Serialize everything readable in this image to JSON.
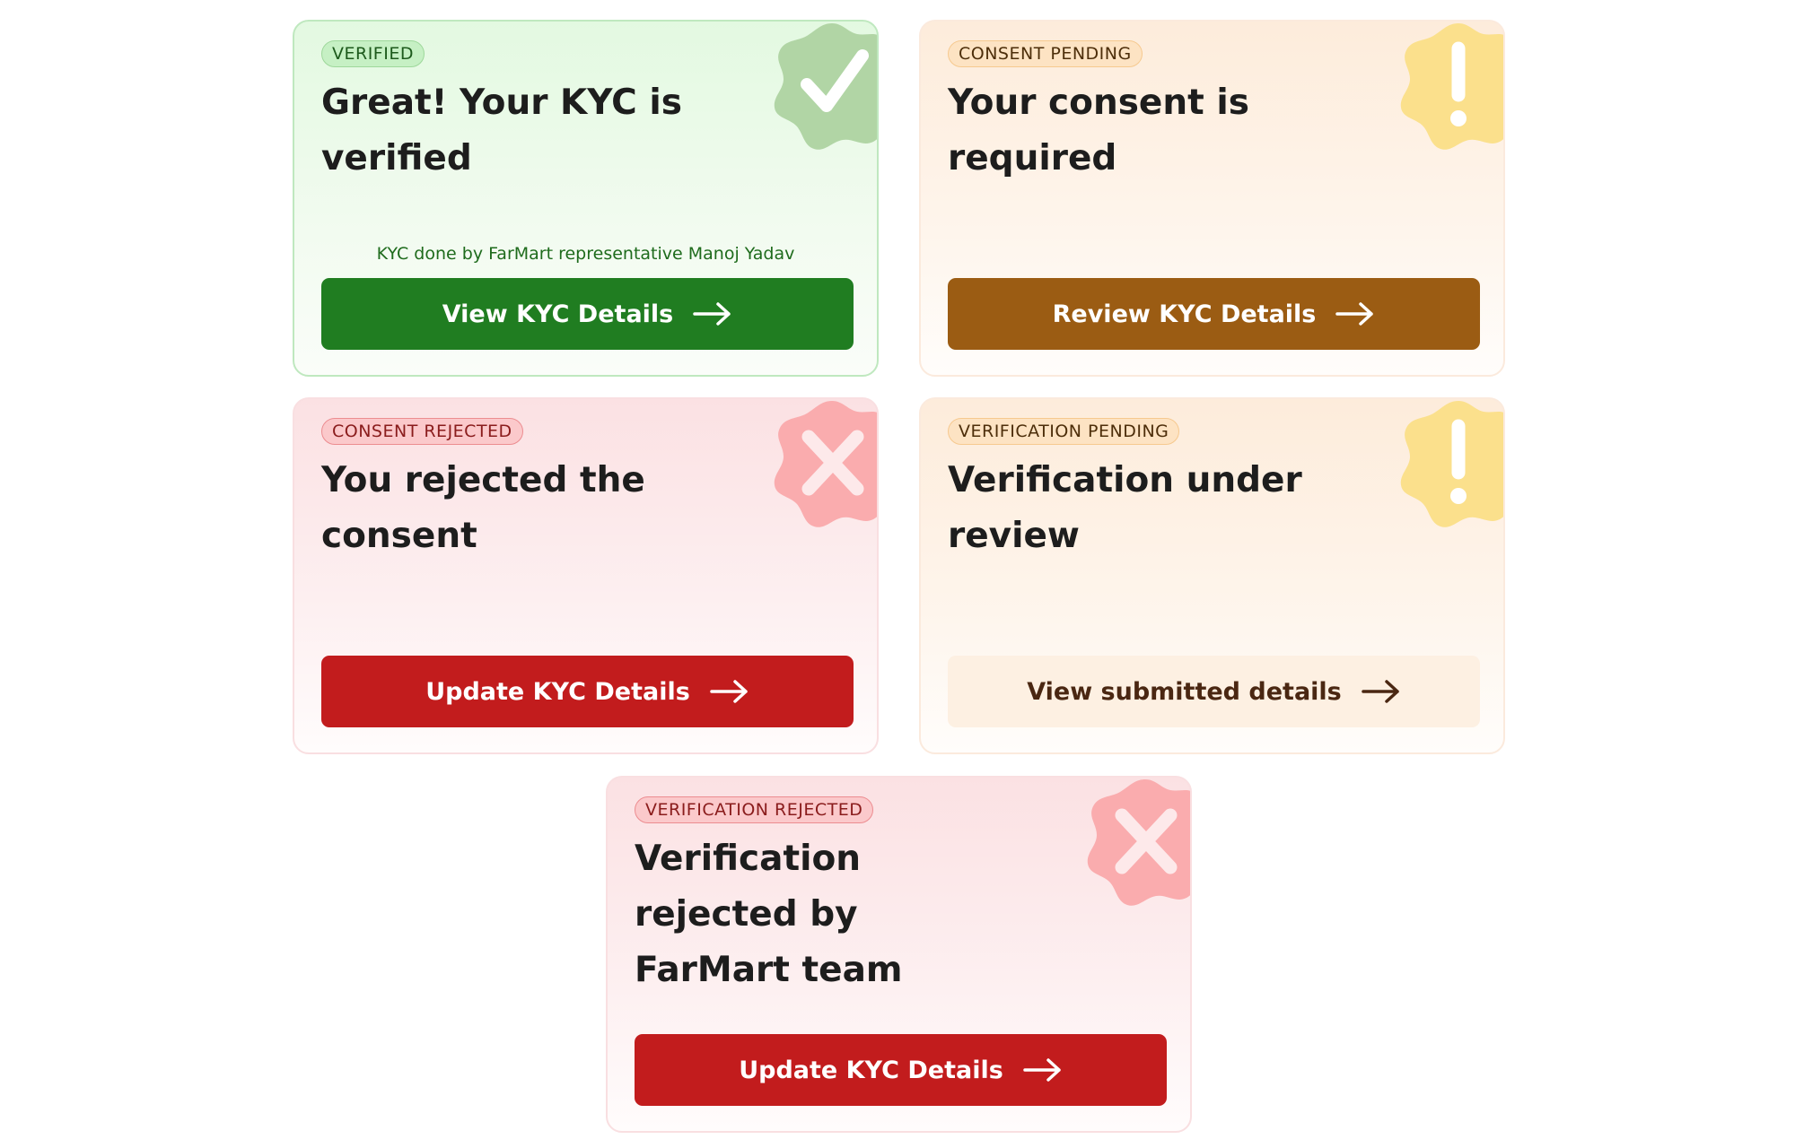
{
  "cards": [
    {
      "badge": "VERIFIED",
      "title": "Great! Your KYC is verified",
      "note": "KYC done by FarMart representative Manoj Yadav",
      "button": "View KYC Details",
      "icon": "check-seal-icon",
      "theme": "green"
    },
    {
      "badge": "CONSENT PENDING",
      "title": "Your consent is required",
      "button": "Review KYC Details",
      "icon": "exclamation-seal-icon",
      "theme": "orange"
    },
    {
      "badge": "CONSENT REJECTED",
      "title": "You rejected the consent",
      "button": "Update KYC Details",
      "icon": "cross-seal-icon",
      "theme": "red"
    },
    {
      "badge": "VERIFICATION PENDING",
      "title": "Verification under review",
      "button": "View submitted details",
      "icon": "exclamation-seal-icon",
      "theme": "orange"
    },
    {
      "badge": "VERIFICATION REJECTED",
      "title": "Verification rejected by FarMart team",
      "button": "Update KYC Details",
      "icon": "cross-seal-icon",
      "theme": "red"
    }
  ],
  "colors": {
    "verified_button": "#207d21",
    "consent_pending_button": "#9b5c13",
    "rejected_button": "#c21c1d",
    "verification_pending_button": "#fdf0e2"
  }
}
